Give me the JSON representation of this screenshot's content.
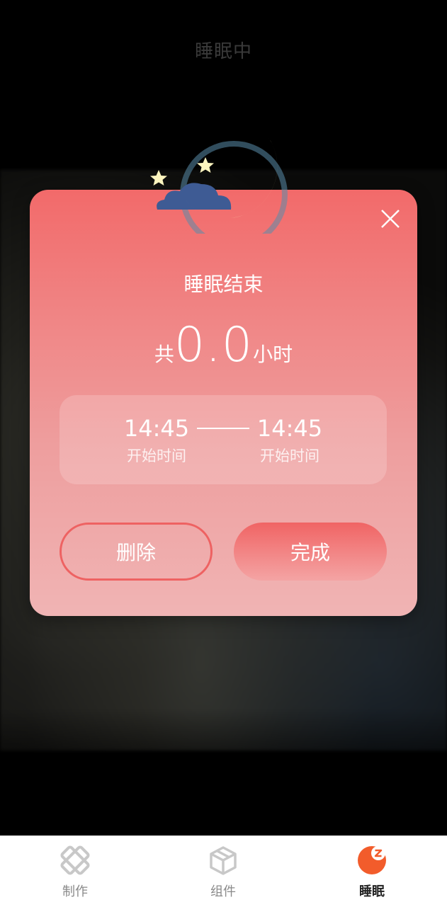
{
  "screen": {
    "title": "睡眠中"
  },
  "dialog": {
    "title": "睡眠结束",
    "total_prefix": "共",
    "total_value": "0.0",
    "total_unit": "小时",
    "start_time": "14:45",
    "start_label": "开始时间",
    "end_time": "14:45",
    "end_label": "开始时间",
    "delete_label": "删除",
    "done_label": "完成"
  },
  "tabbar": {
    "items": [
      {
        "label": "制作",
        "icon": "make-icon"
      },
      {
        "label": "组件",
        "icon": "widget-box-icon"
      },
      {
        "label": "睡眠",
        "icon": "sleep-icon",
        "active": true
      }
    ]
  },
  "colors": {
    "modal_top": "#f26a6a",
    "modal_bottom": "#f0b4b4",
    "accent": "#f25c2b",
    "moon": "#fdf5bf",
    "cloud": "#3e5b94"
  }
}
